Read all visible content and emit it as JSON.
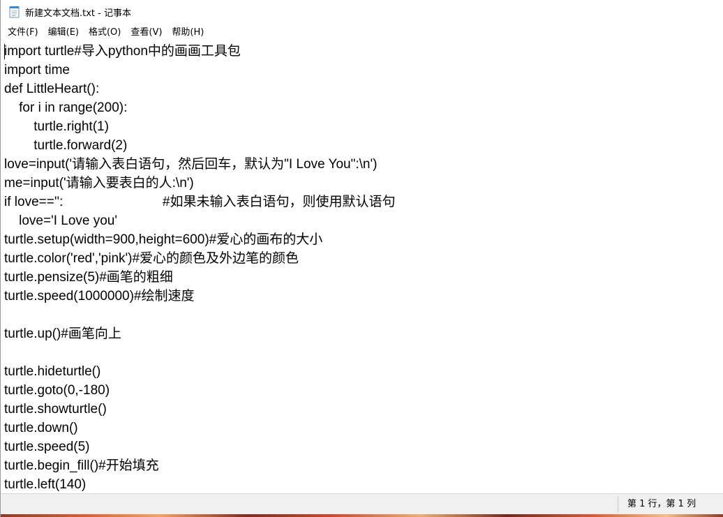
{
  "window": {
    "title": "新建文本文档.txt - 记事本",
    "icon": "notepad-icon"
  },
  "menu": [
    {
      "label": "文件(F)"
    },
    {
      "label": "编辑(E)"
    },
    {
      "label": "格式(O)"
    },
    {
      "label": "查看(V)"
    },
    {
      "label": "帮助(H)"
    }
  ],
  "editor": {
    "lines": [
      "import turtle#导入python中的画画工具包",
      "import time",
      "def LittleHeart():",
      "    for i in range(200):",
      "        turtle.right(1)",
      "        turtle.forward(2)",
      "love=input('请输入表白语句，然后回车，默认为\"I Love You\":\\n')",
      "me=input('请输入要表白的人:\\n')",
      "if love=='':                           #如果未输入表白语句，则使用默认语句",
      "    love='I Love you'",
      "turtle.setup(width=900,height=600)#爱心的画布的大小",
      "turtle.color('red','pink')#爱心的颜色及外边笔的颜色",
      "turtle.pensize(5)#画笔的粗细",
      "turtle.speed(1000000)#绘制速度",
      "",
      "turtle.up()#画笔向上",
      "",
      "turtle.hideturtle()",
      "turtle.goto(0,-180)",
      "turtle.showturtle()",
      "turtle.down()",
      "turtle.speed(5)",
      "turtle.begin_fill()#开始填充",
      "turtle.left(140)"
    ]
  },
  "status": {
    "position": "第 1 行，第 1 列"
  }
}
